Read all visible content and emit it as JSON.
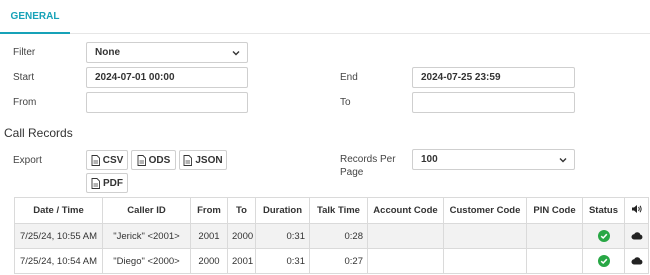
{
  "tabs": [
    {
      "label": "GENERAL",
      "active": true
    }
  ],
  "form": {
    "filter_label": "Filter",
    "filter_value": "None",
    "start_label": "Start",
    "start_value": "2024-07-01 00:00",
    "end_label": "End",
    "end_value": "2024-07-25 23:59",
    "from_label": "From",
    "from_value": "",
    "to_label": "To",
    "to_value": ""
  },
  "section_title": "Call Records",
  "export": {
    "label": "Export",
    "buttons": [
      "CSV",
      "ODS",
      "JSON",
      "PDF"
    ]
  },
  "records_per_page": {
    "label_line1": "Records Per",
    "label_line2": "Page",
    "value": "100"
  },
  "table": {
    "headers": [
      "Date / Time",
      "Caller ID",
      "From",
      "To",
      "Duration",
      "Talk Time",
      "Account Code",
      "Customer Code",
      "PIN Code",
      "Status",
      "volume-icon"
    ],
    "rows": [
      {
        "datetime": "7/25/24, 10:55 AM",
        "caller_id": "\"Jerick\" <2001>",
        "from": "2001",
        "to": "2000",
        "duration": "0:31",
        "talk_time": "0:28",
        "account_code": "",
        "customer_code": "",
        "pin_code": "",
        "status": "check-circle-icon",
        "recording": "cloud-icon"
      },
      {
        "datetime": "7/25/24, 10:54 AM",
        "caller_id": "\"Diego\" <2000>",
        "from": "2000",
        "to": "2001",
        "duration": "0:31",
        "talk_time": "0:27",
        "account_code": "",
        "customer_code": "",
        "pin_code": "",
        "status": "check-circle-icon",
        "recording": "cloud-icon"
      }
    ]
  },
  "colors": {
    "accent": "#17a2b8",
    "status_ok": "#28a745"
  }
}
